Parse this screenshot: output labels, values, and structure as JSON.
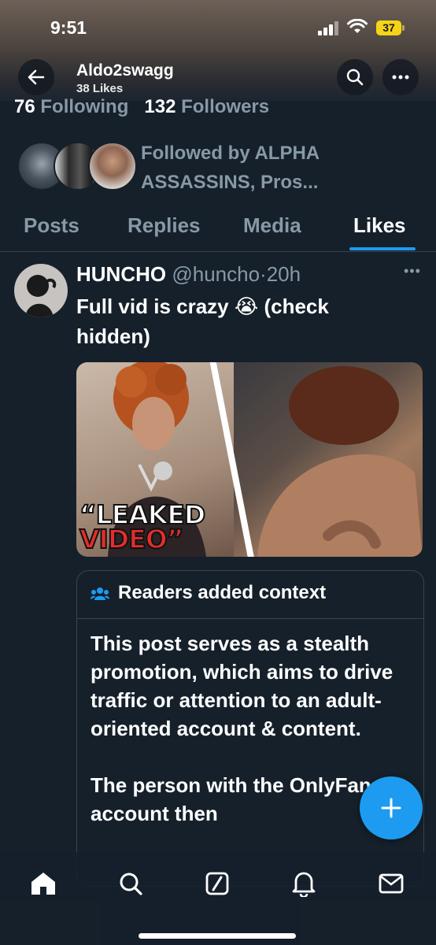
{
  "status_bar": {
    "time": "9:51",
    "battery": "37"
  },
  "profile": {
    "name": "Aldo2swagg",
    "likes_count": "38 Likes",
    "following_count": "76",
    "following_label": "Following",
    "followers_count": "132",
    "followers_label": "Followers",
    "followed_by": "Followed by ALPHA ASSASSINS, Pros..."
  },
  "tabs": [
    {
      "label": "Posts",
      "active": false
    },
    {
      "label": "Replies",
      "active": false
    },
    {
      "label": "Media",
      "active": false
    },
    {
      "label": "Likes",
      "active": true
    }
  ],
  "post": {
    "author_name": "HUNCHO",
    "author_handle": "@huncho",
    "separator": "·",
    "time": "20h",
    "text": "Full vid is crazy 😭 (check hidden)",
    "media_caption_line1": "“LEAKED",
    "media_caption_line2": "VIDEO”"
  },
  "context": {
    "title": "Readers added context",
    "paragraphs": [
      "This post serves as a stealth promotion, which aims to drive traffic or attention to an adult-oriented account & content.",
      "The person with the OnlyFans account then"
    ]
  },
  "icons": {
    "back": "arrow-left-icon",
    "search": "search-icon",
    "more": "more-horizontal-icon",
    "compose": "plus-icon",
    "nav": [
      "home-icon",
      "search-icon",
      "grok-icon",
      "notifications-icon",
      "messages-icon"
    ]
  },
  "colors": {
    "background": "#15202b",
    "accent": "#1d9bf0",
    "muted_text": "#8899a6",
    "border": "#38444d",
    "battery": "#f5d417"
  }
}
